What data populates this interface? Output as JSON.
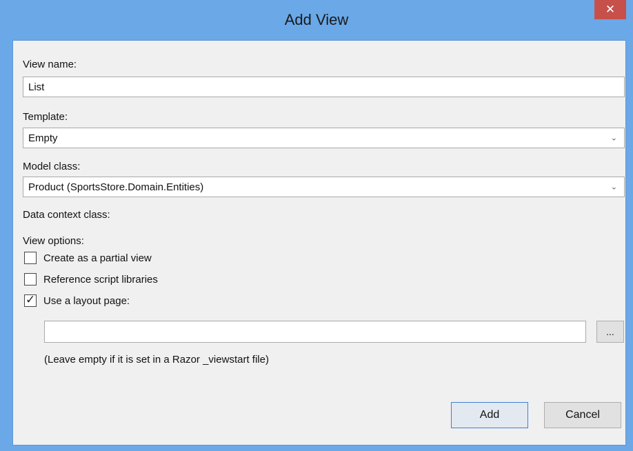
{
  "window": {
    "title": "Add View",
    "close_glyph": "✕"
  },
  "form": {
    "view_name_label": "View name:",
    "view_name_value": "List",
    "template_label": "Template:",
    "template_value": "Empty",
    "model_class_label": "Model class:",
    "model_class_value": "Product (SportsStore.Domain.Entities)",
    "data_context_label": "Data context class:",
    "view_options_label": "View options:",
    "options": [
      {
        "label": "Create as a partial view",
        "checked": false
      },
      {
        "label": "Reference script libraries",
        "checked": false
      },
      {
        "label": "Use a layout page:",
        "checked": true
      }
    ],
    "layout_page_value": "",
    "browse_label": "...",
    "hint": "(Leave empty if it is set in a Razor _viewstart file)"
  },
  "buttons": {
    "add": "Add",
    "cancel": "Cancel"
  },
  "colors": {
    "title_bar": "#6aa8e8",
    "close_button": "#c7504a",
    "dialog_bg": "#f0f0f0"
  }
}
